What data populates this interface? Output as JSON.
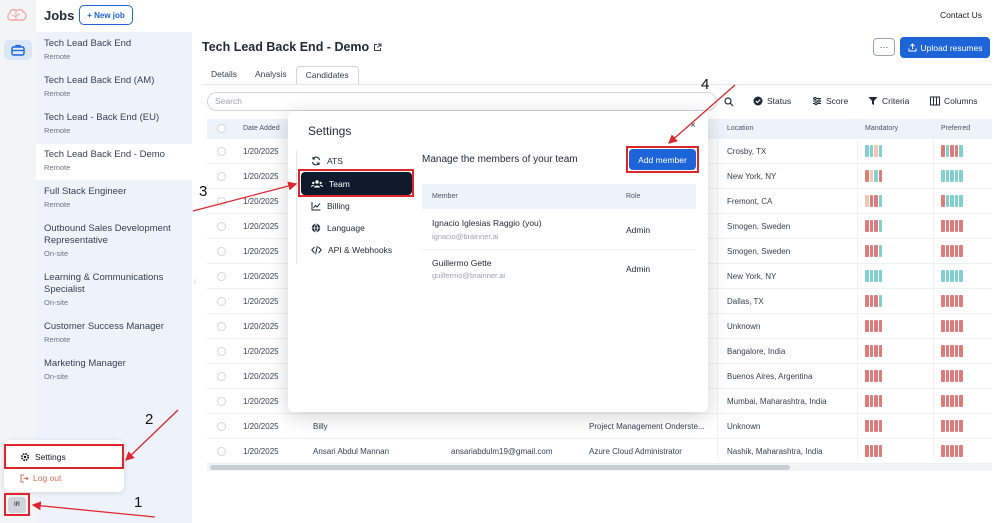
{
  "header": {
    "jobs_title": "Jobs",
    "new_job_label": "+ New job",
    "contact_label": "Contact Us"
  },
  "avatar_initials": "IR",
  "jobs": [
    {
      "title": "Tech Lead Back End",
      "location": "Remote"
    },
    {
      "title": "Tech Lead Back End (AM)",
      "location": "Remote"
    },
    {
      "title": "Tech Lead - Back End (EU)",
      "location": "Remote"
    },
    {
      "title": "Tech Lead Back End - Demo",
      "location": "Remote"
    },
    {
      "title": "Full Stack Engineer",
      "location": "Remote"
    },
    {
      "title": "Outbound Sales Development Representative",
      "location": "On-site"
    },
    {
      "title": "Learning & Communications Specialist",
      "location": "On-site"
    },
    {
      "title": "Customer Success Manager",
      "location": "Remote"
    },
    {
      "title": "Marketing Manager",
      "location": "On-site"
    }
  ],
  "user_menu": {
    "settings_label": "Settings",
    "logout_label": "Log out"
  },
  "main": {
    "title": "Tech Lead Back End - Demo",
    "more_label": "···",
    "upload_label": "Upload resumes",
    "tabs": [
      "Details",
      "Analysis",
      "Candidates"
    ],
    "search_placeholder": "Search",
    "tools": [
      "Status",
      "Score",
      "Criteria",
      "Columns"
    ],
    "columns": [
      "Date Added",
      "Location",
      "Mandatory",
      "Preferred"
    ],
    "rows": [
      {
        "date": "1/20/2025",
        "name": "",
        "email": "",
        "position": "",
        "location": "Crosby, TX"
      },
      {
        "date": "1/20/2025",
        "name": "",
        "email": "",
        "position": "",
        "location": "New York, NY"
      },
      {
        "date": "1/20/2025",
        "name": "",
        "email": "",
        "position": "",
        "location": "Fremont, CA"
      },
      {
        "date": "1/20/2025",
        "name": "",
        "email": "",
        "position": "",
        "location": "Smogen, Sweden"
      },
      {
        "date": "1/20/2025",
        "name": "",
        "email": "",
        "position": "",
        "location": "Smogen, Sweden"
      },
      {
        "date": "1/20/2025",
        "name": "",
        "email": "",
        "position": "",
        "location": "New York, NY"
      },
      {
        "date": "1/20/2025",
        "name": "",
        "email": "",
        "position": "",
        "location": "Dallas, TX"
      },
      {
        "date": "1/20/2025",
        "name": "",
        "email": "",
        "position": "",
        "location": "Unknown"
      },
      {
        "date": "1/20/2025",
        "name": "",
        "email": "",
        "position": "",
        "location": "Bangalore, India"
      },
      {
        "date": "1/20/2025",
        "name": "",
        "email": "",
        "position": "",
        "location": "Buenos Aires, Argentina"
      },
      {
        "date": "1/20/2025",
        "name": "",
        "email": "",
        "position": "",
        "location": "Mumbai, Maharashtra, India"
      },
      {
        "date": "1/20/2025",
        "name": "Billy",
        "email": "",
        "position": "Project Management Onderste...",
        "location": "Unknown"
      },
      {
        "date": "1/20/2025",
        "name": "Ansari Abdul Mannan",
        "email": "ansariabdulm19@gmail.com",
        "position": "Azure Cloud Administrator",
        "location": "Nashik, Maharashtra, India"
      }
    ]
  },
  "colors": {
    "accent": "#1d64d8",
    "bar_red": "#e07b7b",
    "bar_teal": "#7fd0cf",
    "bar_peach": "#f2c7b0",
    "annotation": "#e0262d"
  },
  "bar_patterns": [
    {
      "mandatory": [
        "teal",
        "teal",
        "peach",
        "teal"
      ],
      "preferred": [
        "red",
        "teal",
        "red",
        "red",
        "teal"
      ]
    },
    {
      "mandatory": [
        "red",
        "peach",
        "teal",
        "red"
      ],
      "preferred": [
        "teal",
        "teal",
        "teal",
        "teal",
        "teal"
      ]
    },
    {
      "mandatory": [
        "peach",
        "red",
        "red",
        "teal"
      ],
      "preferred": [
        "red",
        "teal",
        "teal",
        "teal",
        "teal"
      ]
    },
    {
      "mandatory": [
        "red",
        "red",
        "red",
        "teal"
      ],
      "preferred": [
        "red",
        "red",
        "red",
        "red",
        "red"
      ]
    },
    {
      "mandatory": [
        "red",
        "red",
        "red",
        "teal"
      ],
      "preferred": [
        "red",
        "red",
        "red",
        "red",
        "red"
      ]
    },
    {
      "mandatory": [
        "teal",
        "teal",
        "teal",
        "teal"
      ],
      "preferred": [
        "teal",
        "teal",
        "teal",
        "teal",
        "teal"
      ]
    },
    {
      "mandatory": [
        "red",
        "red",
        "red",
        "teal"
      ],
      "preferred": [
        "red",
        "red",
        "red",
        "red",
        "red"
      ]
    },
    {
      "mandatory": [
        "red",
        "red",
        "red",
        "red"
      ],
      "preferred": [
        "red",
        "red",
        "red",
        "red",
        "red"
      ]
    },
    {
      "mandatory": [
        "red",
        "red",
        "red",
        "red"
      ],
      "preferred": [
        "red",
        "red",
        "red",
        "red",
        "red"
      ]
    },
    {
      "mandatory": [
        "red",
        "red",
        "red",
        "red"
      ],
      "preferred": [
        "red",
        "red",
        "red",
        "red",
        "red"
      ]
    },
    {
      "mandatory": [
        "red",
        "red",
        "red",
        "red"
      ],
      "preferred": [
        "red",
        "red",
        "red",
        "red",
        "red"
      ]
    },
    {
      "mandatory": [
        "red",
        "red",
        "red",
        "red"
      ],
      "preferred": [
        "red",
        "red",
        "red",
        "red",
        "red"
      ]
    },
    {
      "mandatory": [
        "red",
        "red",
        "red",
        "red"
      ],
      "preferred": [
        "red",
        "red",
        "red",
        "red",
        "red"
      ]
    }
  ],
  "settings_modal": {
    "title": "Settings",
    "close_label": "×",
    "nav": [
      "ATS",
      "Team",
      "Billing",
      "Language",
      "API & Webhooks"
    ],
    "heading": "Manage the members of your team",
    "add_member_label": "Add member",
    "columns": [
      "Member",
      "Role"
    ],
    "members": [
      {
        "name": "Ignacio Iglesias Raggio (you)",
        "email": "ignacio@brainner.ai",
        "role": "Admin"
      },
      {
        "name": "Guillermo Gette",
        "email": "guillermo@brainner.ai",
        "role": "Admin"
      }
    ]
  },
  "annotations": [
    "1",
    "2",
    "3",
    "4"
  ]
}
